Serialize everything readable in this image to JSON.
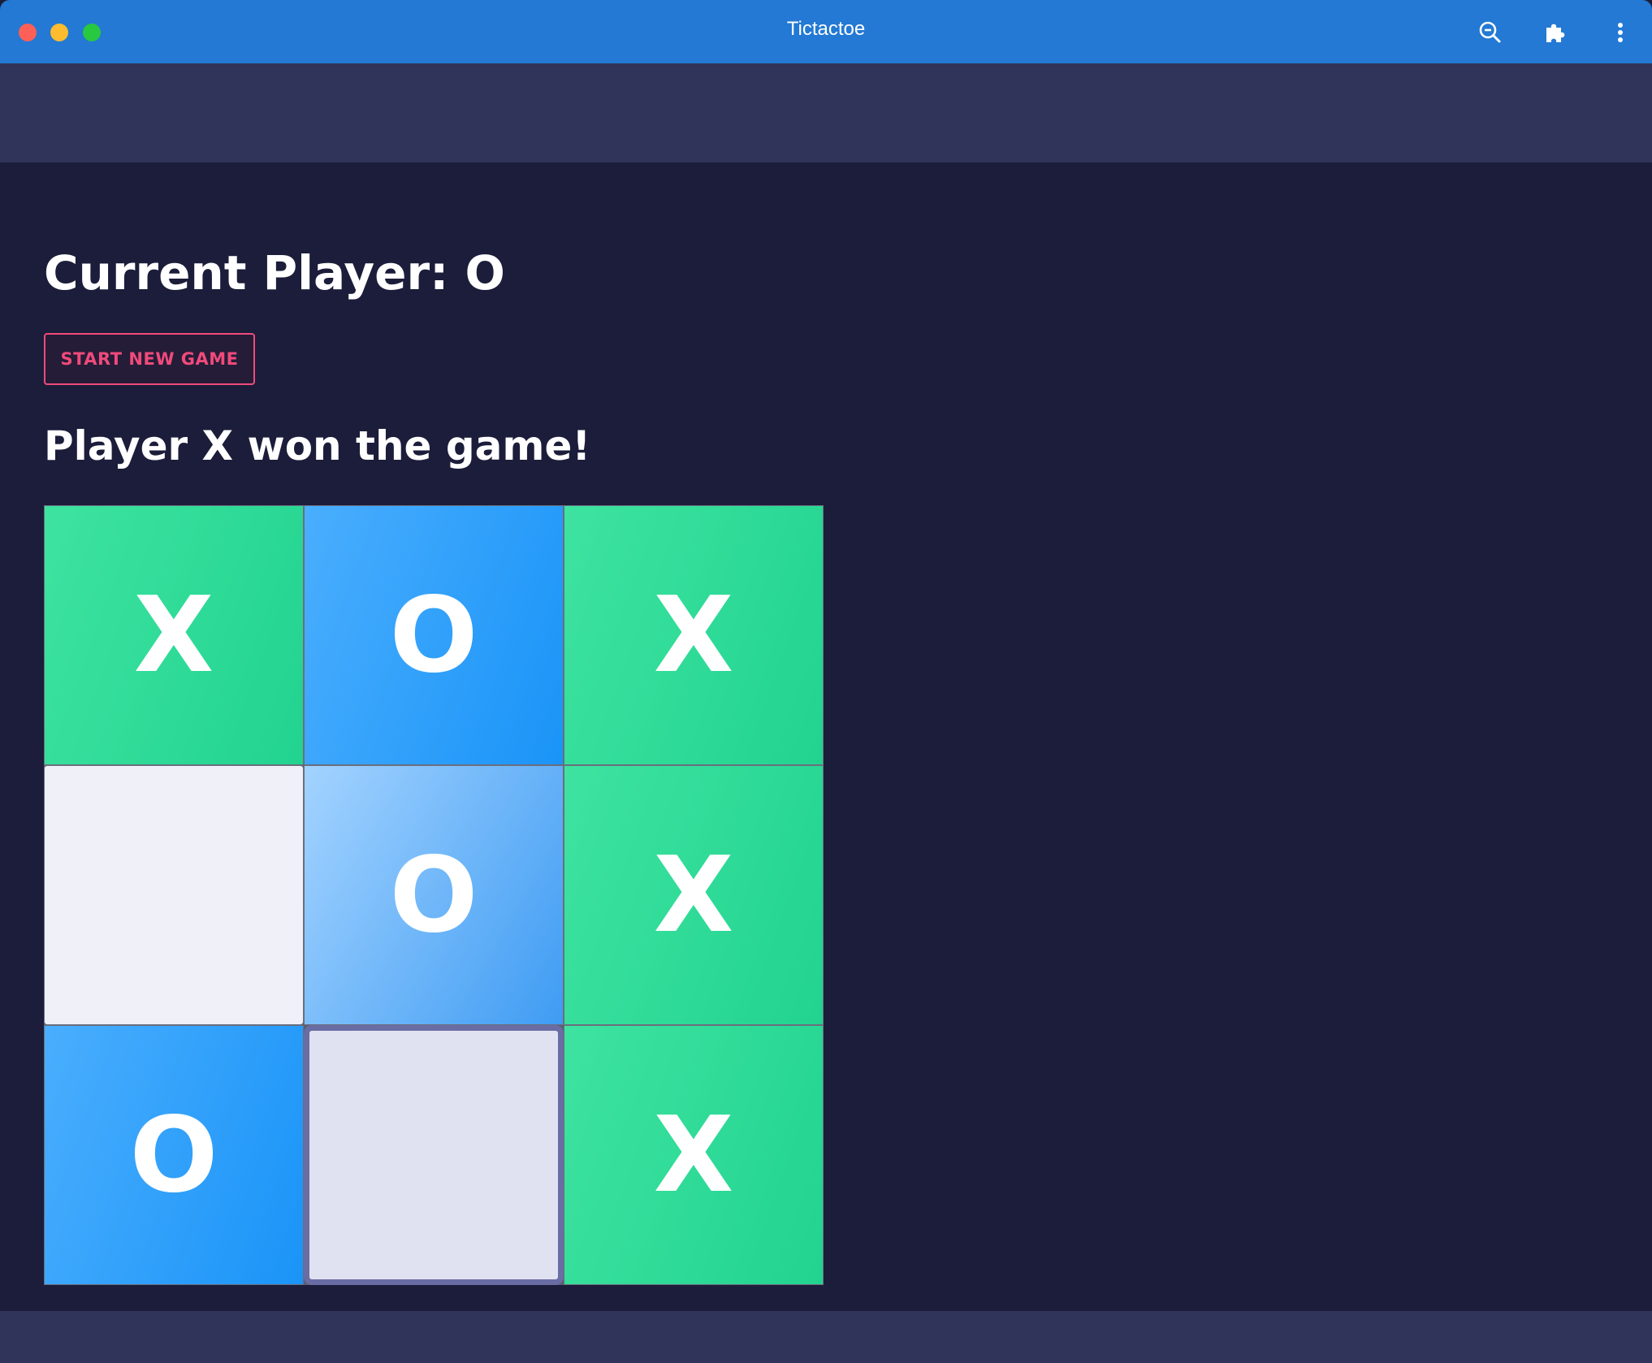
{
  "window": {
    "title": "Tictactoe"
  },
  "toolbar_icons": [
    "zoom-out-icon",
    "puzzle-extension-icon",
    "more-vertical-icon"
  ],
  "game": {
    "current_player_text": "Current Player: O",
    "new_game_label": "START NEW GAME",
    "status_text": "Player X won the game!",
    "board": [
      [
        "X",
        "O",
        "X"
      ],
      [
        "",
        "O",
        "X"
      ],
      [
        "O",
        "",
        "X"
      ]
    ]
  },
  "colors": {
    "titlebar": "#2379d4",
    "header": "#31345a",
    "background": "#1b1d3a",
    "accent": "#f04a7a",
    "x_cell": "#22d390",
    "o_cell": "#1a94f8"
  }
}
